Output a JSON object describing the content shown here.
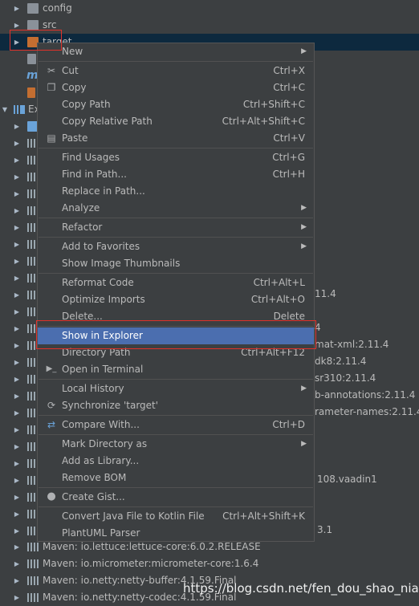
{
  "tree": {
    "rows": [
      {
        "label": "config"
      },
      {
        "label": "src"
      },
      {
        "label": "target"
      },
      {
        "label": ""
      },
      {
        "label": "m"
      },
      {
        "label": ""
      },
      {
        "label": "Ext"
      }
    ],
    "fragments": [
      "11.4",
      "4",
      "mat-xml:2.11.4",
      "dk8:2.11.4",
      "sr310:2.11.4",
      "b-annotations:2.11.4",
      "rameter-names:2.11.4",
      "108.vaadin1",
      "3.1"
    ],
    "maven_rows": [
      "Maven: io.lettuce:lettuce-core:6.0.2.RELEASE",
      "Maven: io.micrometer:micrometer-core:1.6.4",
      "Maven: io.netty:netty-buffer:4.1.59.Final",
      "Maven: io.netty:netty-codec:4.1.59.Final"
    ]
  },
  "menu": {
    "new": "New",
    "cut": "Cut",
    "cut_sc": "Ctrl+X",
    "copy": "Copy",
    "copy_sc": "Ctrl+C",
    "copy_path": "Copy Path",
    "copy_path_sc": "Ctrl+Shift+C",
    "copy_rel": "Copy Relative Path",
    "copy_rel_sc": "Ctrl+Alt+Shift+C",
    "paste": "Paste",
    "paste_sc": "Ctrl+V",
    "find_usages": "Find Usages",
    "find_usages_sc": "Ctrl+G",
    "find_in_path": "Find in Path...",
    "find_in_path_sc": "Ctrl+H",
    "replace_in_path": "Replace in Path...",
    "analyze": "Analyze",
    "refactor": "Refactor",
    "add_fav": "Add to Favorites",
    "show_thumbs": "Show Image Thumbnails",
    "reformat": "Reformat Code",
    "reformat_sc": "Ctrl+Alt+L",
    "optimize": "Optimize Imports",
    "optimize_sc": "Ctrl+Alt+O",
    "delete": "Delete...",
    "delete_sc": "Delete",
    "show_explorer": "Show in Explorer",
    "dir_path": "Directory Path",
    "dir_path_sc": "Ctrl+Alt+F12",
    "open_terminal": "Open in Terminal",
    "local_history": "Local History",
    "sync": "Synchronize 'target'",
    "compare": "Compare With...",
    "compare_sc": "Ctrl+D",
    "mark_dir": "Mark Directory as",
    "add_lib": "Add as Library...",
    "remove_bom": "Remove BOM",
    "create_gist": "Create Gist...",
    "convert_kotlin": "Convert Java File to Kotlin File",
    "convert_kotlin_sc": "Ctrl+Alt+Shift+K",
    "plantuml": "PlantUML Parser"
  },
  "watermark": "https://blog.csdn.net/fen_dou_shao_nian"
}
